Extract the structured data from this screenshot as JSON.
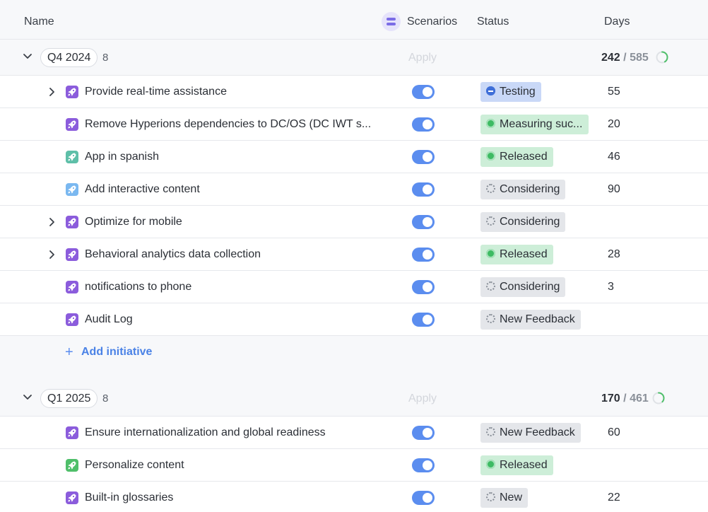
{
  "header": {
    "name_label": "Name",
    "scenarios_label": "Scenarios",
    "status_label": "Status",
    "days_label": "Days"
  },
  "colors": {
    "toggle_on": "#5b8def",
    "badge_testing_bg": "#c9d8f7",
    "badge_released_bg": "#cdeed8",
    "badge_considering_bg": "#e4e6ea",
    "rocket_purple": "#8b5cdc",
    "rocket_teal": "#5ebfa8",
    "rocket_lightblue": "#7ab8f0",
    "rocket_green": "#4fbf6a"
  },
  "groups": [
    {
      "label": "Q4 2024",
      "count": "8",
      "apply_label": "Apply",
      "days_done": "242",
      "days_sep": "/",
      "days_total": "585",
      "progress_fraction": 0.41,
      "add_label": "Add initiative",
      "rows": [
        {
          "title": "Provide real-time assistance",
          "status": "Testing",
          "days": "55",
          "expandable": true,
          "icon": "rocket-icon",
          "icon_color": "purple",
          "status_kind": "testing"
        },
        {
          "title": "Remove Hyperions dependencies to DC/OS (DC IWT s...",
          "status": "Measuring suc...",
          "days": "20",
          "expandable": false,
          "icon": "rocket-icon",
          "icon_color": "purple",
          "status_kind": "released"
        },
        {
          "title": "App in spanish",
          "status": "Released",
          "days": "46",
          "expandable": false,
          "icon": "rocket-icon",
          "icon_color": "teal",
          "status_kind": "released"
        },
        {
          "title": "Add interactive content",
          "status": "Considering",
          "days": "90",
          "expandable": false,
          "icon": "rocket-icon",
          "icon_color": "lightblue",
          "status_kind": "considering"
        },
        {
          "title": "Optimize for mobile",
          "status": "Considering",
          "days": "",
          "expandable": true,
          "icon": "rocket-icon",
          "icon_color": "purple",
          "status_kind": "considering"
        },
        {
          "title": "Behavioral analytics data collection",
          "status": "Released",
          "days": "28",
          "expandable": true,
          "icon": "rocket-icon",
          "icon_color": "purple",
          "status_kind": "released"
        },
        {
          "title": "notifications to phone",
          "status": "Considering",
          "days": "3",
          "expandable": false,
          "icon": "rocket-icon",
          "icon_color": "purple",
          "status_kind": "considering"
        },
        {
          "title": "Audit Log",
          "status": "New Feedback",
          "days": "",
          "expandable": false,
          "icon": "rocket-icon",
          "icon_color": "purple",
          "status_kind": "considering"
        }
      ]
    },
    {
      "label": "Q1 2025",
      "count": "8",
      "apply_label": "Apply",
      "days_done": "170",
      "days_sep": "/",
      "days_total": "461",
      "progress_fraction": 0.37,
      "rows": [
        {
          "title": "Ensure internationalization and global readiness",
          "status": "New Feedback",
          "days": "60",
          "expandable": false,
          "icon": "rocket-icon",
          "icon_color": "purple",
          "status_kind": "considering"
        },
        {
          "title": "Personalize content",
          "status": "Released",
          "days": "",
          "expandable": false,
          "icon": "rocket-icon",
          "icon_color": "green",
          "status_kind": "released"
        },
        {
          "title": "Built-in glossaries",
          "status": "New",
          "days": "22",
          "expandable": false,
          "icon": "rocket-icon",
          "icon_color": "purple",
          "status_kind": "considering"
        }
      ]
    }
  ]
}
